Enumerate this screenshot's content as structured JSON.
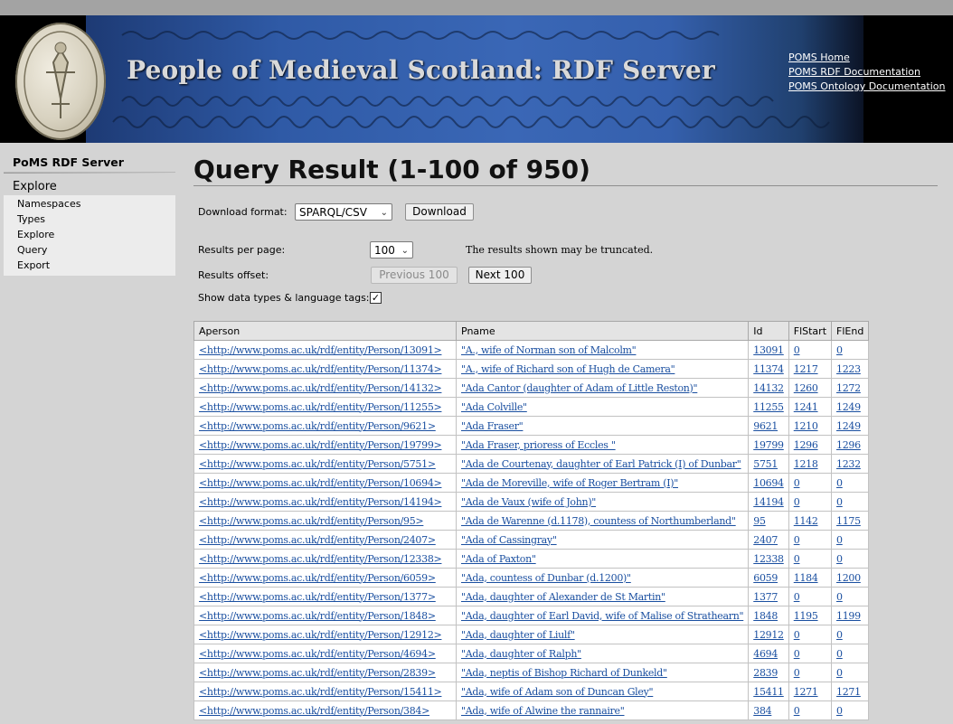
{
  "header": {
    "title": "People of Medieval Scotland: RDF Server",
    "links": [
      "POMS Home",
      "POMS RDF Documentation",
      "POMS Ontology Documentation"
    ]
  },
  "sidebar": {
    "server": "PoMS RDF Server",
    "section": "Explore",
    "items": [
      "Namespaces",
      "Types",
      "Explore",
      "Query",
      "Export"
    ]
  },
  "main": {
    "title": "Query Result (1-100 of 950)",
    "download_label": "Download format:",
    "download_format": "SPARQL/CSV",
    "download_button": "Download",
    "per_page_label": "Results per page:",
    "per_page_value": "100",
    "truncation_note": "The results shown may be truncated.",
    "offset_label": "Results offset:",
    "prev_button": "Previous 100",
    "next_button": "Next 100",
    "datatypes_label": "Show data types & language tags:",
    "datatypes_checked": true
  },
  "table": {
    "headers": [
      "Aperson",
      "Pname",
      "Id",
      "FlStart",
      "FlEnd"
    ],
    "rows": [
      [
        "<http://www.poms.ac.uk/rdf/entity/Person/13091>",
        "\"A., wife of Norman son of Malcolm\"",
        "13091",
        "0",
        "0"
      ],
      [
        "<http://www.poms.ac.uk/rdf/entity/Person/11374>",
        "\"A., wife of Richard son of Hugh de Camera\"",
        "11374",
        "1217",
        "1223"
      ],
      [
        "<http://www.poms.ac.uk/rdf/entity/Person/14132>",
        "\"Ada Cantor (daughter of Adam of Little Reston)\"",
        "14132",
        "1260",
        "1272"
      ],
      [
        "<http://www.poms.ac.uk/rdf/entity/Person/11255>",
        "\"Ada Colville\"",
        "11255",
        "1241",
        "1249"
      ],
      [
        "<http://www.poms.ac.uk/rdf/entity/Person/9621>",
        "\"Ada Fraser\"",
        "9621",
        "1210",
        "1249"
      ],
      [
        "<http://www.poms.ac.uk/rdf/entity/Person/19799>",
        "\"Ada Fraser, prioress of Eccles \"",
        "19799",
        "1296",
        "1296"
      ],
      [
        "<http://www.poms.ac.uk/rdf/entity/Person/5751>",
        "\"Ada de Courtenay, daughter of Earl Patrick (I) of Dunbar\"",
        "5751",
        "1218",
        "1232"
      ],
      [
        "<http://www.poms.ac.uk/rdf/entity/Person/10694>",
        "\"Ada de Moreville, wife of Roger Bertram (I)\"",
        "10694",
        "0",
        "0"
      ],
      [
        "<http://www.poms.ac.uk/rdf/entity/Person/14194>",
        "\"Ada de Vaux (wife of John)\"",
        "14194",
        "0",
        "0"
      ],
      [
        "<http://www.poms.ac.uk/rdf/entity/Person/95>",
        "\"Ada de Warenne (d.1178), countess of Northumberland\"",
        "95",
        "1142",
        "1175"
      ],
      [
        "<http://www.poms.ac.uk/rdf/entity/Person/2407>",
        "\"Ada of Cassingray\"",
        "2407",
        "0",
        "0"
      ],
      [
        "<http://www.poms.ac.uk/rdf/entity/Person/12338>",
        "\"Ada of Paxton\"",
        "12338",
        "0",
        "0"
      ],
      [
        "<http://www.poms.ac.uk/rdf/entity/Person/6059>",
        "\"Ada, countess of Dunbar (d.1200)\"",
        "6059",
        "1184",
        "1200"
      ],
      [
        "<http://www.poms.ac.uk/rdf/entity/Person/1377>",
        "\"Ada, daughter of Alexander de St Martin\"",
        "1377",
        "0",
        "0"
      ],
      [
        "<http://www.poms.ac.uk/rdf/entity/Person/1848>",
        "\"Ada, daughter of Earl David, wife of Malise of Strathearn\"",
        "1848",
        "1195",
        "1199"
      ],
      [
        "<http://www.poms.ac.uk/rdf/entity/Person/12912>",
        "\"Ada, daughter of Liulf\"",
        "12912",
        "0",
        "0"
      ],
      [
        "<http://www.poms.ac.uk/rdf/entity/Person/4694>",
        "\"Ada, daughter of Ralph\"",
        "4694",
        "0",
        "0"
      ],
      [
        "<http://www.poms.ac.uk/rdf/entity/Person/2839>",
        "\"Ada, neptis of Bishop Richard of Dunkeld\"",
        "2839",
        "0",
        "0"
      ],
      [
        "<http://www.poms.ac.uk/rdf/entity/Person/15411>",
        "\"Ada, wife of Adam son of Duncan Gley\"",
        "15411",
        "1271",
        "1271"
      ],
      [
        "<http://www.poms.ac.uk/rdf/entity/Person/384>",
        "\"Ada, wife of Alwine the rannaire\"",
        "384",
        "0",
        "0"
      ]
    ]
  }
}
